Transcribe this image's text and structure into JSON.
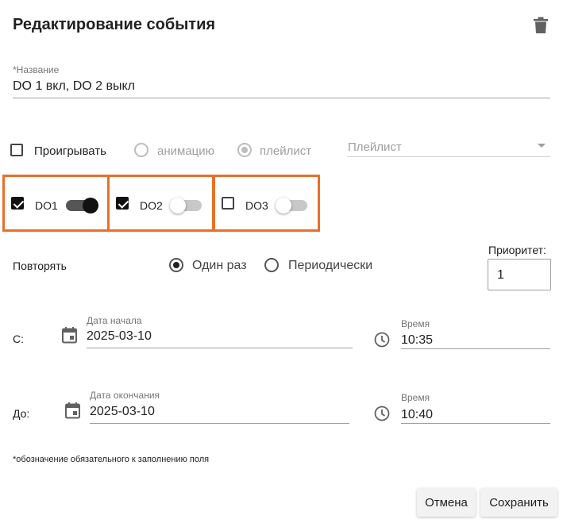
{
  "dialog": {
    "title": "Редактирование события"
  },
  "name_field": {
    "label": "*Название",
    "value": "DO 1 вкл, DO 2 выкл"
  },
  "playback": {
    "play_label": "Проигрывать",
    "play_checked": false,
    "animation_label": "анимацию",
    "playlist_label": "плейлист",
    "selected": "playlist",
    "playlist_placeholder": "Плейлист"
  },
  "outputs": [
    {
      "label": "DO1",
      "checked": true,
      "on": true
    },
    {
      "label": "DO2",
      "checked": true,
      "on": false
    },
    {
      "label": "DO3",
      "checked": false,
      "on": false
    }
  ],
  "repeat": {
    "label": "Повторять",
    "once_label": "Один раз",
    "periodic_label": "Периодически",
    "selected": "once"
  },
  "priority": {
    "label": "Приоритет:",
    "value": "1"
  },
  "from": {
    "label": "С:",
    "date_label": "Дата начала",
    "date_value": "2025-03-10",
    "time_label": "Время",
    "time_value": "10:35"
  },
  "to": {
    "label": "До:",
    "date_label": "Дата окончания",
    "date_value": "2025-03-10",
    "time_label": "Время",
    "time_value": "10:40"
  },
  "footnote": "*обозначение обязательного к заполнению поля",
  "actions": {
    "cancel_label": "Отмена",
    "save_label": "Сохранить"
  },
  "colors": {
    "highlight": "#e8702a",
    "text": "#212121",
    "disabled": "#9e9e9e"
  }
}
